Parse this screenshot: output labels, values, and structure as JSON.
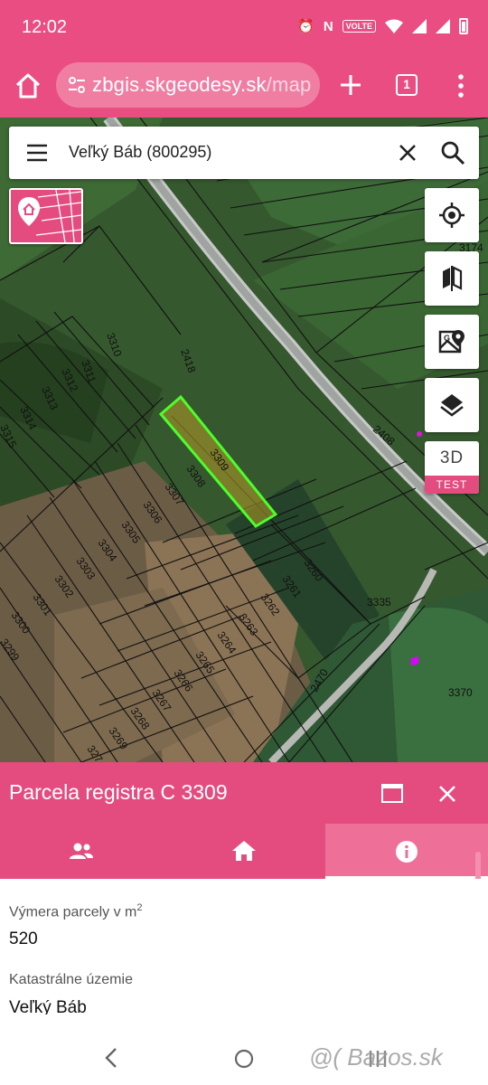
{
  "status_bar": {
    "time": "12:02",
    "volte": "VOLTE",
    "icons": [
      "alarm-icon",
      "nfc-icon",
      "volte-icon",
      "wifi-icon",
      "signal-icon",
      "signal-icon",
      "battery-icon"
    ]
  },
  "browser": {
    "url_host": "zbgis.skgeodesy.sk",
    "url_path": "/map",
    "tab_count": "1"
  },
  "search": {
    "query": "Veľký Báb (800295)"
  },
  "map": {
    "parcel_labels": [
      "3311",
      "3310",
      "2418",
      "3312",
      "3313",
      "3314",
      "3315",
      "3309",
      "3308",
      "3307",
      "3306",
      "3305",
      "3304",
      "3303",
      "3302",
      "3301",
      "3300",
      "3299",
      "3260",
      "3261",
      "3262",
      "3263",
      "3264",
      "3265",
      "3266",
      "3267",
      "3268",
      "3269",
      "327",
      "3335",
      "3370",
      "2470",
      "2408",
      "3174"
    ],
    "selected_parcel": "3309",
    "highlight_color": "#4cff2a"
  },
  "tools": {
    "three_d_label": "3D",
    "test_badge": "TEST"
  },
  "sheet": {
    "title": "Parcela registra C 3309",
    "fields": [
      {
        "label": "Výmera parcely v m",
        "sup": "2",
        "value": "520"
      },
      {
        "label": "Katastrálne územie",
        "value": "Veľký Báb"
      }
    ]
  },
  "watermark": "@( Bazos.sk",
  "colors": {
    "accent": "#e44c80",
    "accent_light": "#ee6f98"
  }
}
